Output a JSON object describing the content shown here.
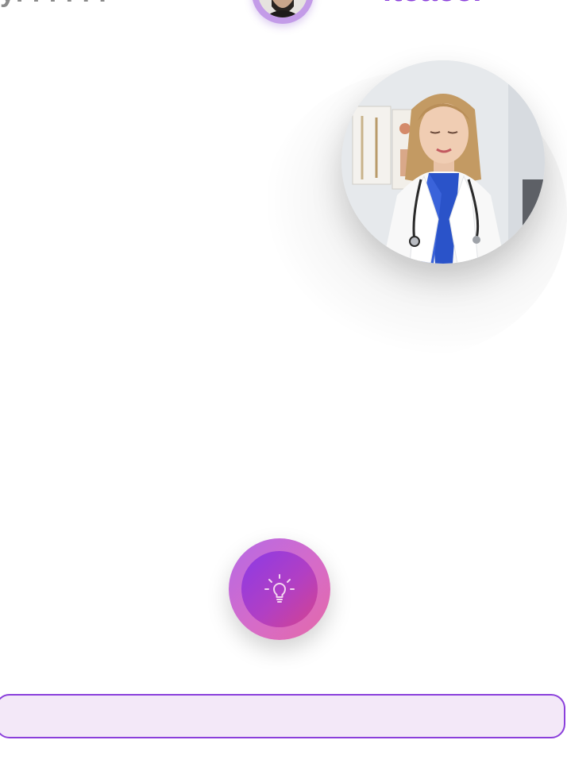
{
  "header": {
    "left_text": "ÿ. . . . . .",
    "right_text": "iteaeer"
  },
  "input": {
    "value": "",
    "placeholder": ""
  },
  "icons": {
    "hint": "lightbulb-icon"
  },
  "colors": {
    "accent": "#8a3fdb",
    "input_bg": "#f3e8f8",
    "hint_inner_start": "#8b3ae6",
    "hint_inner_end": "#d4438f"
  }
}
